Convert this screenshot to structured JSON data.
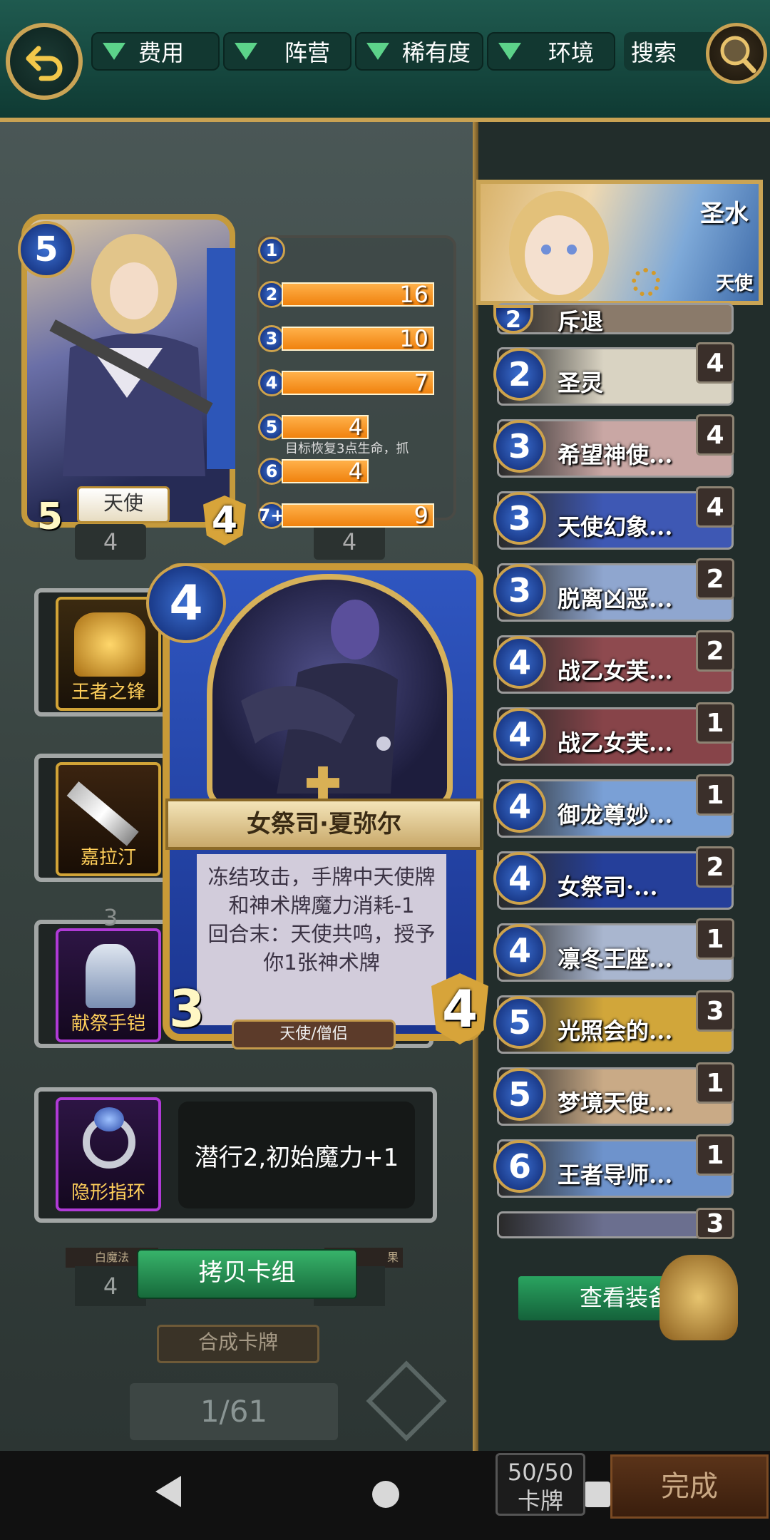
{
  "topbar": {
    "filters": [
      "费用",
      "阵营",
      "稀有度",
      "环境"
    ],
    "search_label": "搜索"
  },
  "hero": {
    "cost": "5",
    "attack": "5",
    "health": "4",
    "name": "天使"
  },
  "mana_curve": {
    "rows": [
      {
        "cost": "1",
        "count": ""
      },
      {
        "cost": "2",
        "count": "16",
        "fill": 0.89
      },
      {
        "cost": "3",
        "count": "10",
        "fill": 0.89
      },
      {
        "cost": "4",
        "count": "7",
        "fill": 0.89
      },
      {
        "cost": "5",
        "count": "4",
        "fill": 0.51
      },
      {
        "cost": "6",
        "count": "4",
        "fill": 0.51
      },
      {
        "cost": "7+",
        "count": "9",
        "fill": 0.89
      }
    ],
    "overlay_text": "目标恢复3点生命，抓"
  },
  "under_numbers": [
    "4",
    "4"
  ],
  "equipment": [
    {
      "name": "王者之锋"
    },
    {
      "name": "嘉拉汀"
    },
    {
      "name": "献祭手铠"
    },
    {
      "name": "隐形指环",
      "desc": "潜行2,初始魔力+1"
    }
  ],
  "background_labels": [
    "3",
    "4",
    "白魔法",
    "果",
    "4",
    "4"
  ],
  "copy_deck_label": "拷贝卡组",
  "merge_cards_label": "合成卡牌",
  "page_indicator": "1/61",
  "popup_card": {
    "cost": "4",
    "name": "女祭司·夏弥尔",
    "description": "冻结攻击，手牌中天使牌和神术牌魔力消耗-1\n回合末：天使共鸣，授予你1张神术牌",
    "attack": "3",
    "health": "4",
    "type": "天使/僧侣"
  },
  "deck_hero": {
    "name": "圣水",
    "class": "天使"
  },
  "deck": [
    {
      "cost": "2",
      "name": "斥退",
      "count": ""
    },
    {
      "cost": "2",
      "name": "圣灵",
      "count": "4",
      "color": "#d9d3c2"
    },
    {
      "cost": "3",
      "name": "希望神使...",
      "count": "4",
      "color": "#c9a7a4"
    },
    {
      "cost": "3",
      "name": "天使幻象...",
      "count": "4",
      "color": "#3e58b4"
    },
    {
      "cost": "3",
      "name": "脱离凶恶...",
      "count": "2",
      "color": "#8fa6cf"
    },
    {
      "cost": "4",
      "name": "战乙女芙...",
      "count": "2",
      "color": "#8e4a4f"
    },
    {
      "cost": "4",
      "name": "战乙女芙...",
      "count": "1",
      "color": "#874449"
    },
    {
      "cost": "4",
      "name": "御龙尊妙...",
      "count": "1",
      "color": "#7aa0d6"
    },
    {
      "cost": "4",
      "name": "女祭司·...",
      "count": "2",
      "color": "#253f9a"
    },
    {
      "cost": "4",
      "name": "凛冬王座...",
      "count": "1",
      "color": "#a9b6cf"
    },
    {
      "cost": "5",
      "name": "光照会的...",
      "count": "3",
      "color": "#d1a63a"
    },
    {
      "cost": "5",
      "name": "梦境天使...",
      "count": "1",
      "color": "#c9aa86"
    },
    {
      "cost": "6",
      "name": "王者导师...",
      "count": "1",
      "color": "#6e93cc"
    },
    {
      "cost": "",
      "name": "",
      "count": "3",
      "color": "#6b6f8f"
    }
  ],
  "view_equipment_label": "查看装备",
  "deck_count": {
    "value": "50/50",
    "label": "卡牌"
  },
  "done_label": "完成",
  "colors": {
    "accent_gold": "#c9a253",
    "bar_orange": "#f59a2a",
    "topbar_green": "#1f5a4f"
  }
}
